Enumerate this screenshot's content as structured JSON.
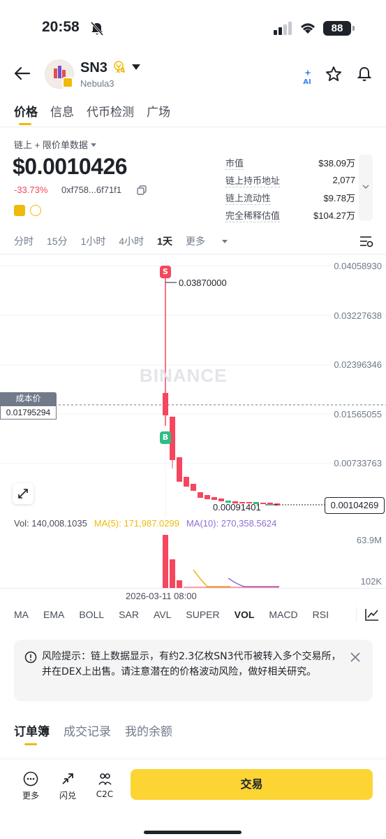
{
  "status": {
    "time": "20:58",
    "battery": "88"
  },
  "header": {
    "symbol": "SN3",
    "badge": "x4",
    "name": "Nebula3",
    "ai_label": "AI"
  },
  "tabs": [
    "价格",
    "信息",
    "代币检测",
    "广场"
  ],
  "price_panel": {
    "source": "链上 + 限价单数据",
    "price": "$0.0010426",
    "change": "-33.73%",
    "address": "0xf758...6f71f1",
    "stats": [
      {
        "k": "市值",
        "v": "$38.09万"
      },
      {
        "k": "链上持币地址",
        "v": "2,077"
      },
      {
        "k": "链上流动性",
        "v": "$9.78万"
      },
      {
        "k": "完全稀释估值",
        "v": "$104.27万"
      }
    ]
  },
  "intervals": [
    "分时",
    "15分",
    "1小时",
    "4小时",
    "1天",
    "更多"
  ],
  "chart": {
    "watermark": "BINANCE",
    "y_ticks": [
      "0.04058930",
      "0.03227638",
      "0.02396346",
      "0.01565055",
      "0.00733763"
    ],
    "cost_label": "成本价",
    "cost_value": "0.01795294",
    "high_label": "0.03870000",
    "low_label": "0.00091401",
    "last_price": "0.00104269",
    "sell_marker": "S",
    "buy_marker": "B",
    "colors": {
      "up": "#2ebd85",
      "down": "#f6465d",
      "ma5": "#f0b90b",
      "ma10": "#8d6fd6"
    }
  },
  "volume": {
    "vol": "Vol: 140,008.1035",
    "ma5": "MA(5): 171,987.0299",
    "ma10": "MA(10): 270,358.5624",
    "max": "63.9M",
    "min": "102K",
    "date": "2026-03-11 08:00"
  },
  "indicators": [
    "MA",
    "EMA",
    "BOLL",
    "SAR",
    "AVL",
    "SUPER",
    "VOL",
    "MACD",
    "RSI"
  ],
  "risk": {
    "text": "风险提示：链上数据显示，有约2.3亿枚SN3代币被转入多个交易所，并在DEX上出售。请注意潜在的价格波动风险，做好相关研究。"
  },
  "book_tabs": [
    "订单簿",
    "成交记录",
    "我的余额"
  ],
  "bottom": {
    "more": "更多",
    "swap": "闪兑",
    "c2c": "C2C",
    "trade": "交易"
  }
}
